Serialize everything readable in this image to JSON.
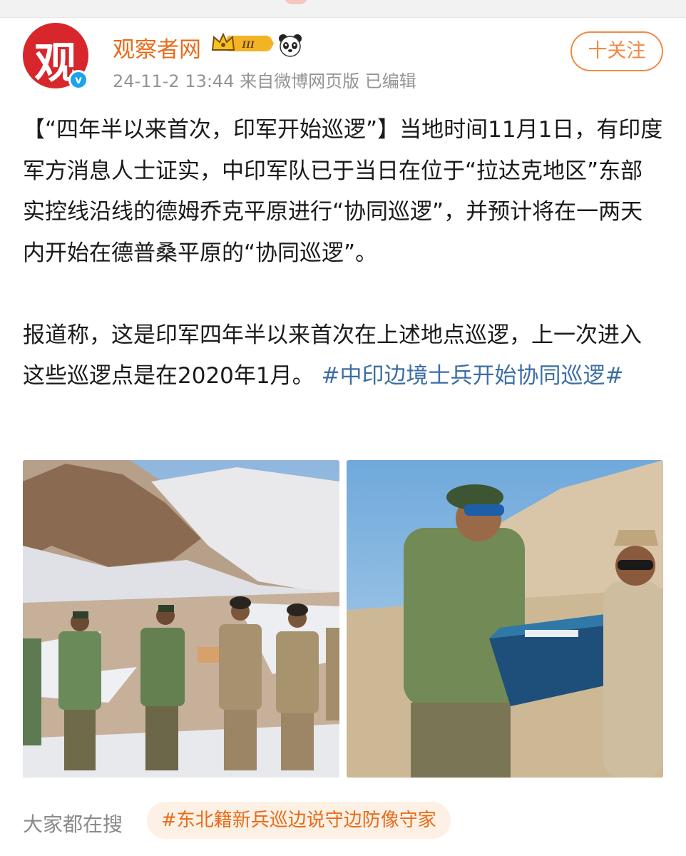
{
  "header": {
    "avatar_char": "观",
    "verified_mark": "v",
    "username": "观察者网",
    "vip_level": "III",
    "meta": "24-11-2 13:44 来自微博网页版 已编辑",
    "follow_label": "十关注"
  },
  "post": {
    "paragraph1": "【“四年半以来首次，印军开始巡逻”】当地时间11月1日，有印度军方消息人士证实，中印军队已于当日在位于“拉达克地区”东部实控线沿线的德姆乔克平原进行“协同巡逻”，并预计将在一两天内开始在德普桑平原的“协同巡逻”。",
    "paragraph2": "报道称，这是印军四年半以来首次在上述地点巡逻，上一次进入这些巡逻点是在2020年1月。",
    "topic": "#中印边境士兵开始协同巡逻#"
  },
  "search": {
    "label": "大家都在搜",
    "pill": "#东北籍新兵巡边说守边防像守家"
  },
  "icons": {
    "vip": "crown-vip-badge-icon",
    "panda": "panda-icon",
    "verified": "verified-badge-icon"
  },
  "colors": {
    "accent": "#e86b19",
    "topic": "#3d6ea4",
    "avatar": "#d7262c",
    "verified": "#1aa3ee"
  }
}
